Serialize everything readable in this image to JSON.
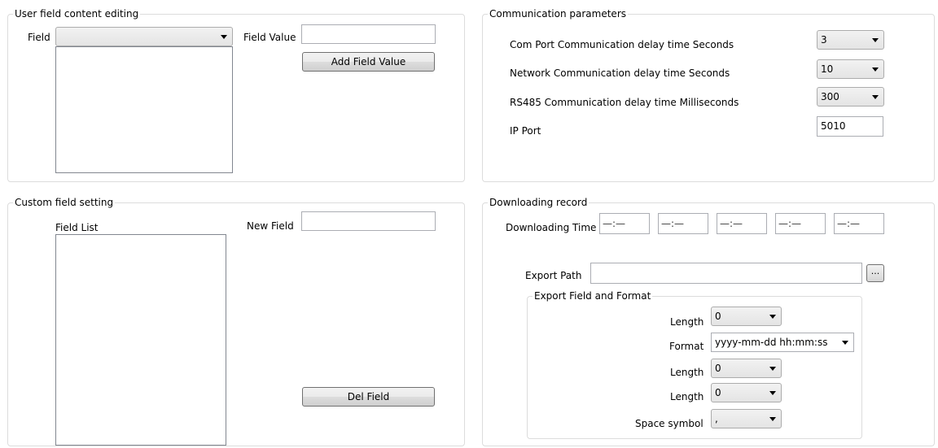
{
  "user_field": {
    "title": "User field content editing",
    "field_label": "Field",
    "field_value_label": "Field Value",
    "field_value": "",
    "add_button": "Add Field Value"
  },
  "comm": {
    "title": "Communication parameters",
    "com_port_label": "Com Port Communication delay time Seconds",
    "com_port_value": "3",
    "network_label": "Network Communication delay time Seconds",
    "network_value": "10",
    "rs485_label": "RS485 Communication delay time Milliseconds",
    "rs485_value": "300",
    "ip_port_label": "IP Port",
    "ip_port_value": "5010"
  },
  "custom_field": {
    "title": "Custom field setting",
    "field_list_label": "Field List",
    "new_field_label": "New Field",
    "new_field_value": "",
    "del_button": "Del Field"
  },
  "download": {
    "title": "Downloading record",
    "time_label": "Downloading Time",
    "time_placeholders": [
      "—:—",
      "—:—",
      "—:—",
      "—:—",
      "—:—"
    ],
    "export_path_label": "Export Path",
    "export_path_value": "",
    "browse_label": "...",
    "export_group_title": "Export Field and Format",
    "rows": [
      {
        "label": "Length",
        "value": "0"
      },
      {
        "label": "Format",
        "value": "yyyy-mm-dd hh:mm:ss"
      },
      {
        "label": "Length",
        "value": "0"
      },
      {
        "label": "Length",
        "value": "0"
      },
      {
        "label": "Space symbol",
        "value": ","
      }
    ]
  }
}
